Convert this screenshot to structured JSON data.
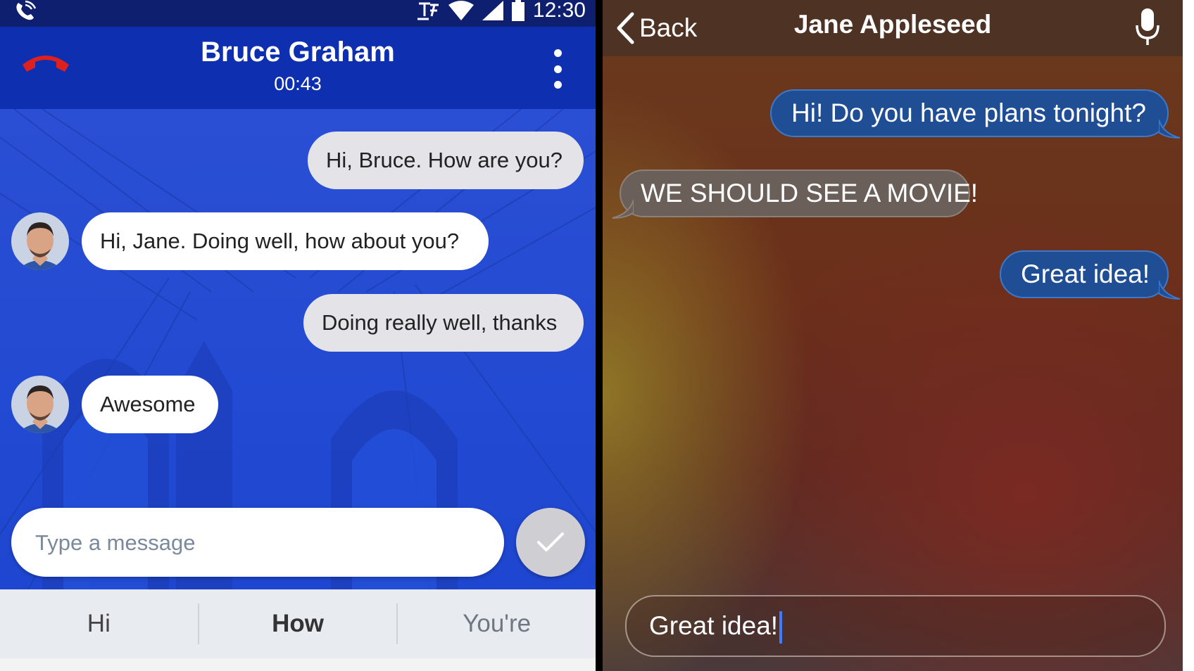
{
  "left": {
    "status": {
      "time": "12:30",
      "call_icon": "phone-in-call-icon",
      "carrier_icon": "tty-icon",
      "wifi_icon": "wifi-icon",
      "signal_icon": "cellular-signal-icon",
      "battery_icon": "battery-icon"
    },
    "header": {
      "contact_name": "Bruce Graham",
      "call_timer": "00:43",
      "hangup_icon": "hang-up-icon",
      "menu_icon": "more-vert-icon"
    },
    "messages": [
      {
        "direction": "outgoing",
        "text": "Hi, Bruce. How are you?"
      },
      {
        "direction": "incoming",
        "text": "Hi, Jane. Doing well, how about you?"
      },
      {
        "direction": "outgoing",
        "text": "Doing really well, thanks"
      },
      {
        "direction": "incoming",
        "text": "Awesome"
      }
    ],
    "composer": {
      "placeholder": "Type a message",
      "value": "",
      "send_icon": "checkmark-icon"
    },
    "suggestions": [
      "Hi",
      "How",
      "You're"
    ]
  },
  "right": {
    "navbar": {
      "back_label": "Back",
      "title": "Jane Appleseed",
      "mic_icon": "microphone-icon"
    },
    "messages": [
      {
        "direction": "sent",
        "text": "Hi! Do you have plans tonight?"
      },
      {
        "direction": "received",
        "text": "WE SHOULD SEE A MOVIE!"
      },
      {
        "direction": "sent",
        "text": "Great idea!"
      }
    ],
    "input": {
      "value": "Great idea!"
    }
  },
  "colors": {
    "android_appbar": "#0e2fb0",
    "android_chat_bg": "#1f49d6",
    "ios_sent_bubble": "#1f4e94",
    "ios_received_bubble": "#6b5f59",
    "hangup_red": "#e0201c"
  }
}
